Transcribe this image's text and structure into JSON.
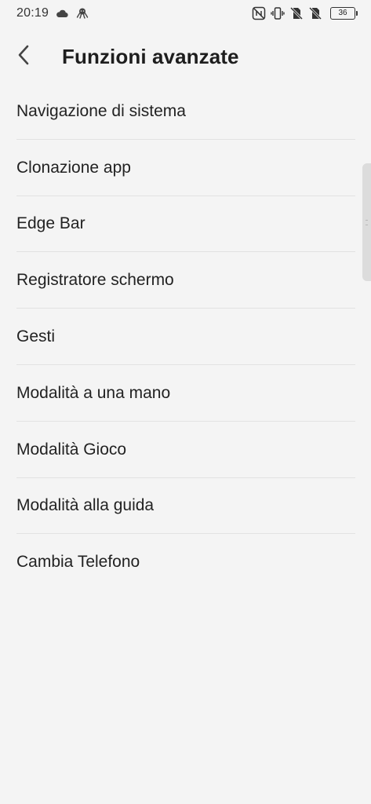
{
  "status_bar": {
    "time": "20:19",
    "left_icons": [
      "cloud-icon",
      "octopus-icon"
    ],
    "right_icons": [
      "nfc-icon",
      "vibrate-icon",
      "no-sim-icon",
      "no-sim-icon"
    ],
    "battery": "36"
  },
  "header": {
    "back_icon": "chevron-left-icon",
    "title": "Funzioni avanzate"
  },
  "menu": {
    "items": [
      {
        "label": "Navigazione di sistema"
      },
      {
        "label": "Clonazione app"
      },
      {
        "label": "Edge Bar"
      },
      {
        "label": "Registratore schermo"
      },
      {
        "label": "Gesti"
      },
      {
        "label": "Modalità a una mano"
      },
      {
        "label": "Modalità Gioco"
      },
      {
        "label": "Modalità alla guida"
      },
      {
        "label": "Cambia Telefono"
      }
    ]
  },
  "colors": {
    "background": "#f4f4f4",
    "text": "#222222",
    "divider": "#e2e2e2"
  }
}
